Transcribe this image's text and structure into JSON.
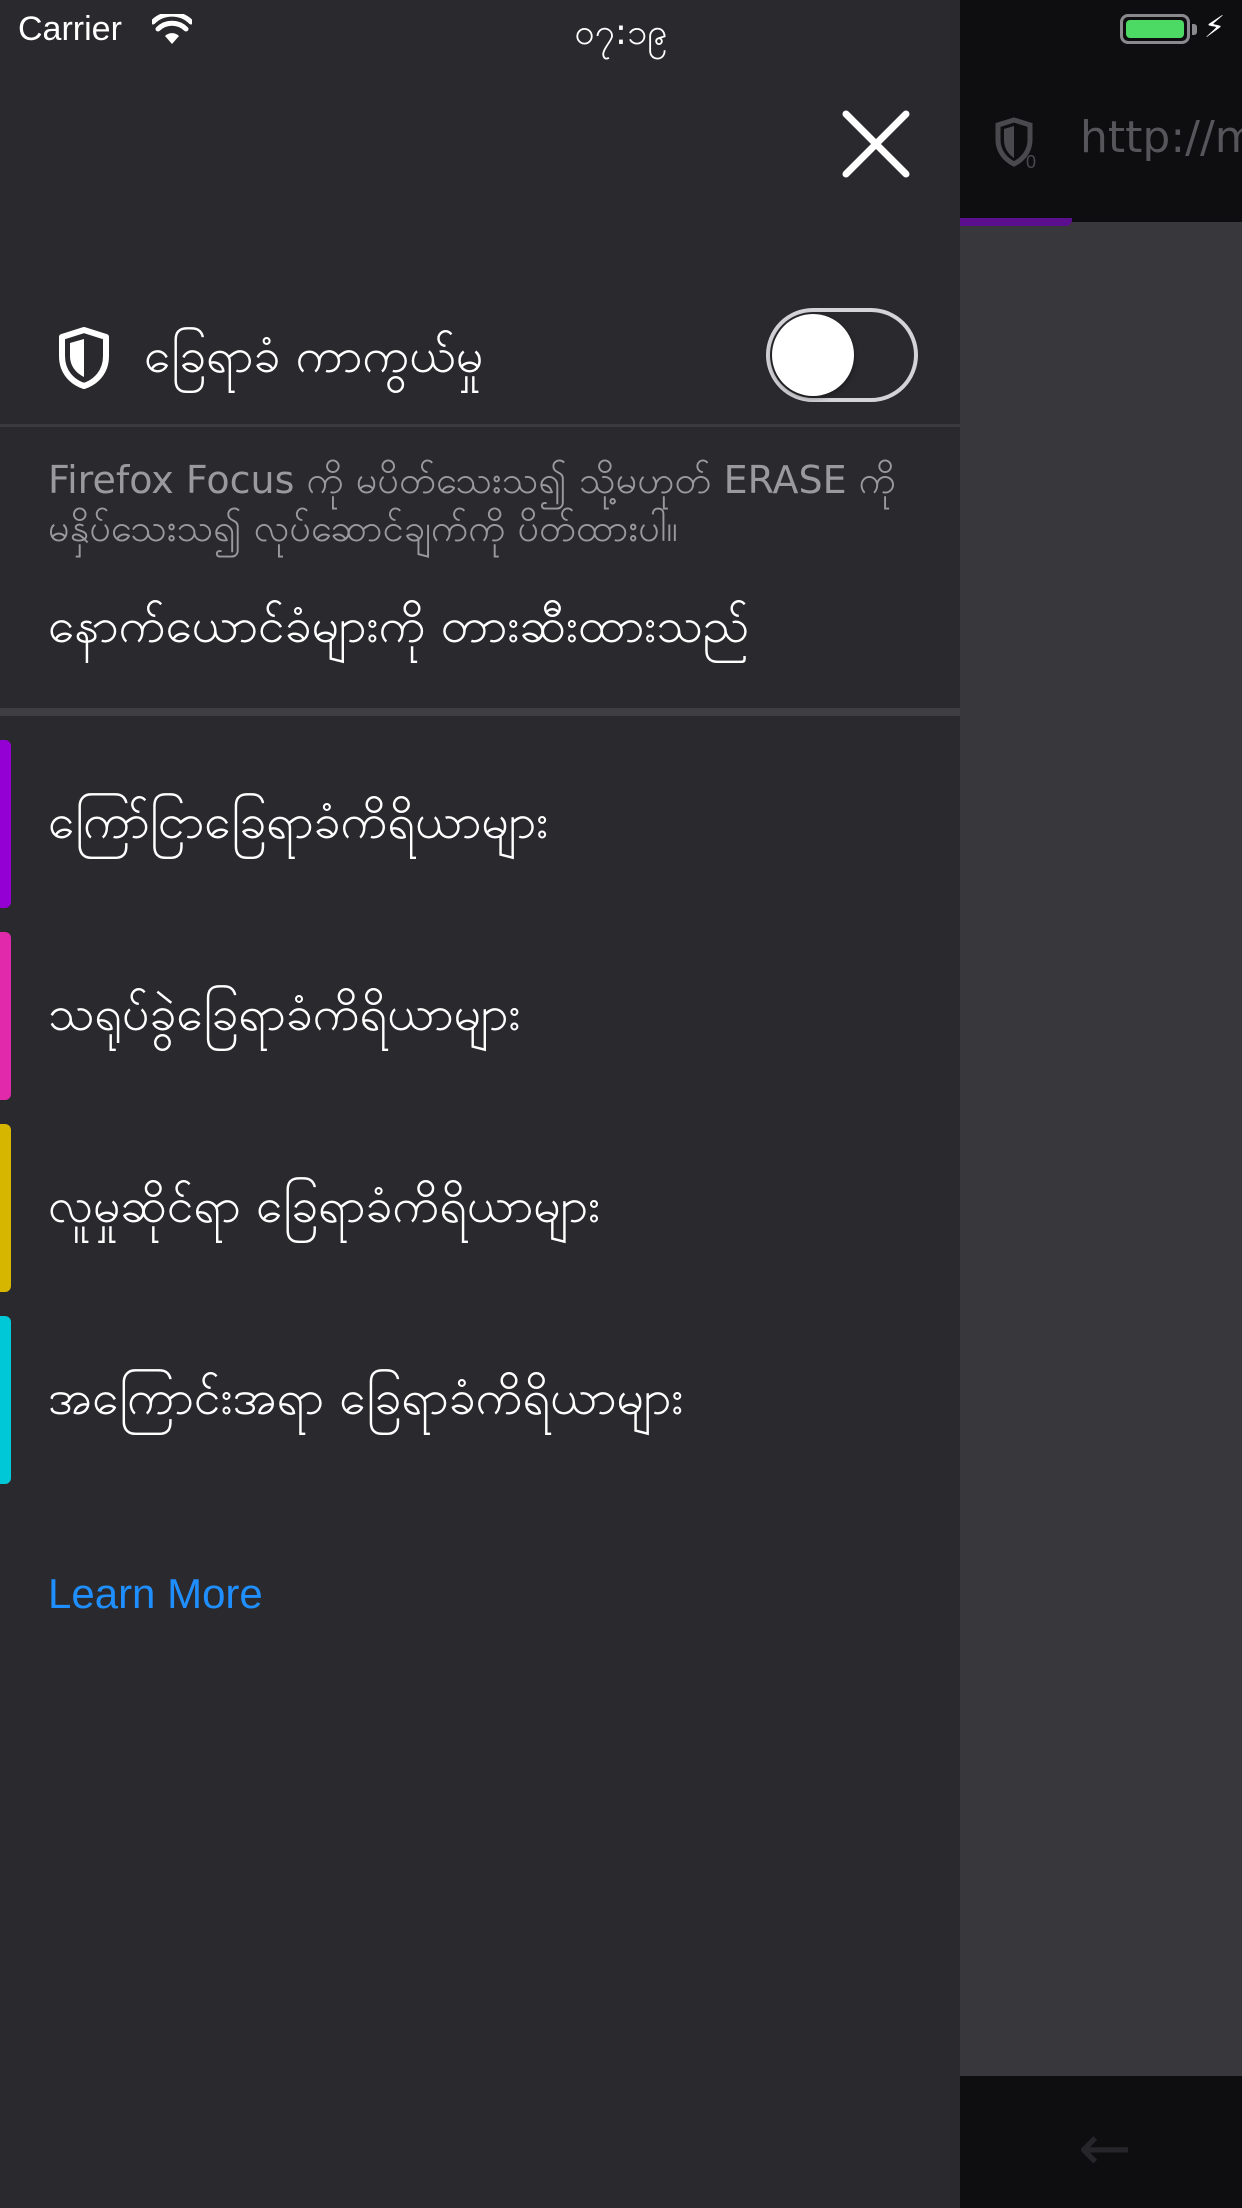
{
  "status_bar": {
    "carrier": "Carrier",
    "time": "၀၇:၁၉"
  },
  "browser": {
    "url_text": "http://m"
  },
  "panel": {
    "toggle_label": "ခြေရာခံ ကာကွယ်မှု",
    "toggle_on": false,
    "description": "Firefox Focus ကို မပိတ်သေးသ၍ သို့မဟုတ် ERASE ကို မနှိပ်သေးသ၍ လုပ်ဆောင်ချက်ကို ပိတ်ထားပါ။",
    "blocked_label": "နောက်ယောင်ခံများကို တားဆီးထားသည်",
    "categories": [
      {
        "label": "ကြော်ငြာခြေရာခံကိရိယာများ",
        "color": "#9400d3"
      },
      {
        "label": "သရုပ်ခွဲခြေရာခံကိရိယာများ",
        "color": "#e02aab"
      },
      {
        "label": "လူမှုဆိုင်ရာ ခြေရာခံကိရိယာများ",
        "color": "#d7b600"
      },
      {
        "label": "အကြောင်းအရာ ခြေရာခံကိရိယာများ",
        "color": "#00c8d7"
      }
    ],
    "learn_more": "Learn More"
  }
}
